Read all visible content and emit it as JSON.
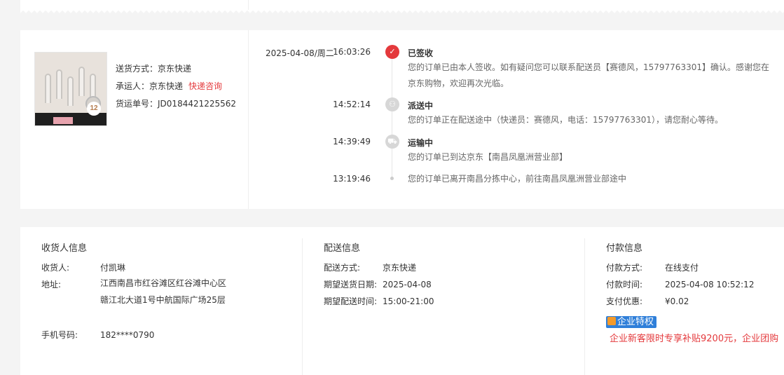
{
  "shipping": {
    "method_label": "送货方式：",
    "method_value": "京东快递",
    "carrier_label": "承运人：",
    "carrier_value": "京东快递",
    "carrier_link": "快递咨询",
    "tracking_label": "货运单号：",
    "tracking_value": "JD0184421225562",
    "thumb_badge": "12"
  },
  "timeline": [
    {
      "date": "2025-04-08/周二",
      "time": "16:03:26",
      "status": "已签收",
      "icon": "check-icon",
      "desc": "您的订单已由本人签收。如有疑问您可以联系配送员【赛德风，15797763301】确认。感谢您在京东购物，欢迎再次光临。"
    },
    {
      "date": "",
      "time": "14:52:14",
      "status": "派送中",
      "icon": "delivery-person-icon",
      "desc": "您的订单正在配送途中（快递员：赛德风，电话：15797763301），请您耐心等待。"
    },
    {
      "date": "",
      "time": "14:39:49",
      "status": "运输中",
      "icon": "truck-icon",
      "desc": "您的订单已到达京东【南昌凤凰洲营业部】"
    },
    {
      "date": "",
      "time": "13:19:46",
      "status": "",
      "icon": "dot-icon",
      "desc": "您的订单已离开南昌分拣中心，前往南昌凤凰洲营业部途中"
    }
  ],
  "receiver": {
    "title": "收货人信息",
    "name_label": "收货人:",
    "name_value": "付凯琳",
    "address_label": "地址:",
    "address_value": "江西南昌市红谷滩区红谷滩中心区赣江北大道1号中航国际广场25层",
    "phone_label": "手机号码:",
    "phone_value": "182****0790"
  },
  "delivery": {
    "title": "配送信息",
    "method_label": "配送方式:",
    "method_value": "京东快递",
    "date_label": "期望送货日期:",
    "date_value": "2025-04-08",
    "time_label": "期望配送时间:",
    "time_value": "15:00-21:00"
  },
  "payment": {
    "title": "付款信息",
    "method_label": "付款方式:",
    "method_value": "在线支付",
    "time_label": "付款时间:",
    "time_value": "2025-04-08 10:52:12",
    "discount_label": "支付优惠:",
    "discount_value": "¥0.02",
    "badge_label": "企业特权",
    "promo_text": "企业新客限时专享补贴9200元，企业团购"
  },
  "colors": {
    "accent_red": "#e4393c",
    "badge_blue": "#2f7fd9"
  }
}
